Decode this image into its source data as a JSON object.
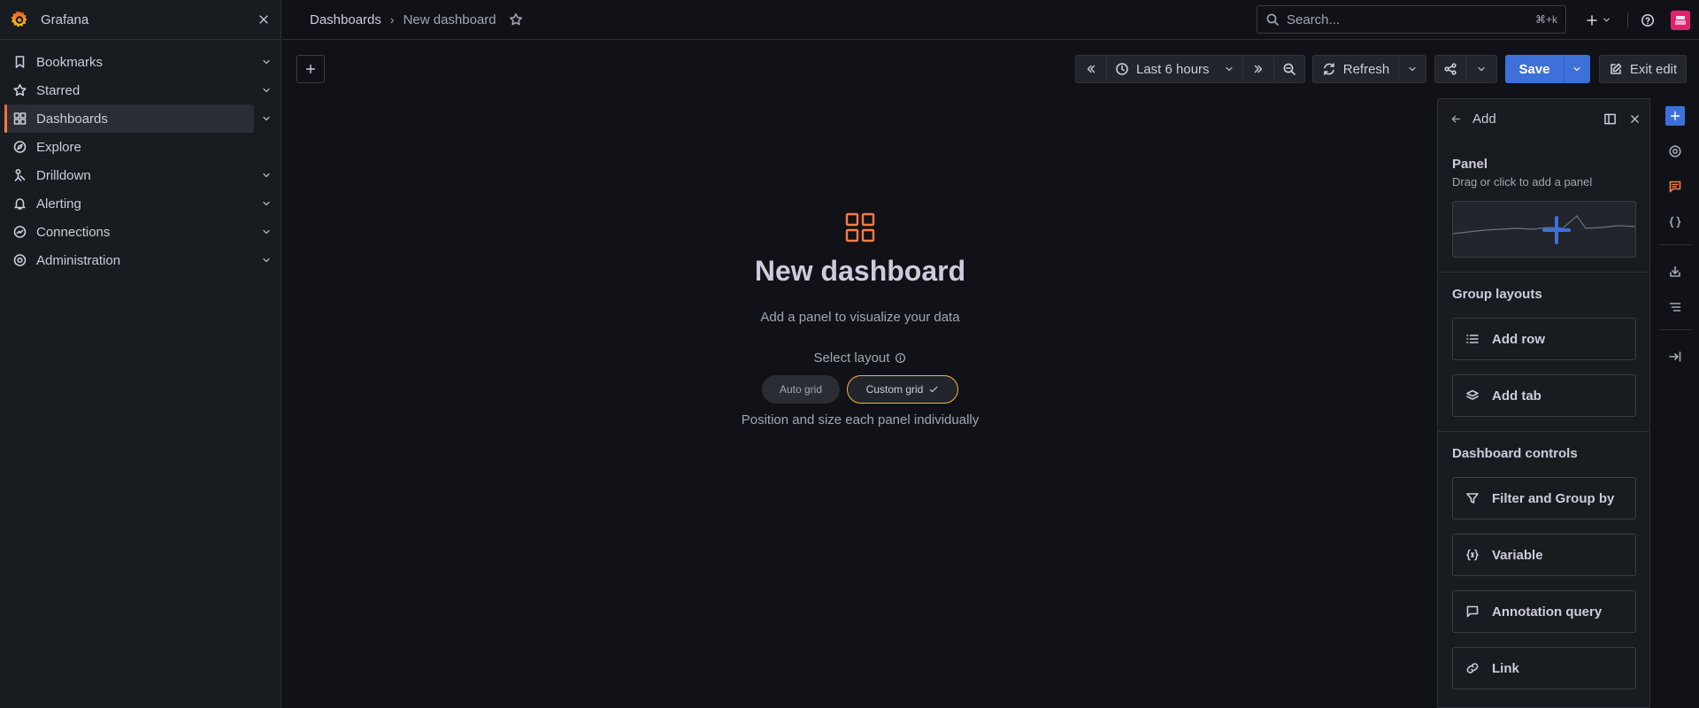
{
  "app": {
    "title": "Grafana"
  },
  "sidebar": {
    "items": [
      {
        "label": "Bookmarks",
        "icon": "bookmark-icon",
        "expandable": true
      },
      {
        "label": "Starred",
        "icon": "star-icon",
        "expandable": true
      },
      {
        "label": "Dashboards",
        "icon": "apps-icon",
        "expandable": true,
        "active": true
      },
      {
        "label": "Explore",
        "icon": "compass-icon",
        "expandable": false
      },
      {
        "label": "Drilldown",
        "icon": "drilldown-icon",
        "expandable": true
      },
      {
        "label": "Alerting",
        "icon": "bell-icon",
        "expandable": true
      },
      {
        "label": "Connections",
        "icon": "link-icon",
        "expandable": true
      },
      {
        "label": "Administration",
        "icon": "gear-icon",
        "expandable": true
      }
    ]
  },
  "breadcrumb": {
    "parent": "Dashboards",
    "current": "New dashboard"
  },
  "search": {
    "placeholder": "Search...",
    "shortcut": "⌘+k"
  },
  "toolbar": {
    "time_range": "Last 6 hours",
    "refresh_label": "Refresh",
    "save_label": "Save",
    "exit_edit_label": "Exit edit"
  },
  "empty_state": {
    "title": "New dashboard",
    "subtitle": "Add a panel to visualize your data",
    "select_layout_label": "Select layout",
    "options": [
      "Auto grid",
      "Custom grid"
    ],
    "selected_option": "Custom grid",
    "description": "Position and size each panel individually"
  },
  "add_panel": {
    "title": "Add",
    "panel_section": {
      "heading": "Panel",
      "hint": "Drag or click to add a panel"
    },
    "group_layouts": {
      "heading": "Group layouts",
      "buttons": [
        "Add row",
        "Add tab"
      ]
    },
    "dashboard_controls": {
      "heading": "Dashboard controls",
      "buttons": [
        "Filter and Group by",
        "Variable",
        "Annotation query",
        "Link"
      ]
    }
  },
  "colors": {
    "accent_blue": "#3d71d9",
    "brand_orange": "#ff7a45",
    "selected_border": "#f5b73d",
    "background": "#111217"
  }
}
